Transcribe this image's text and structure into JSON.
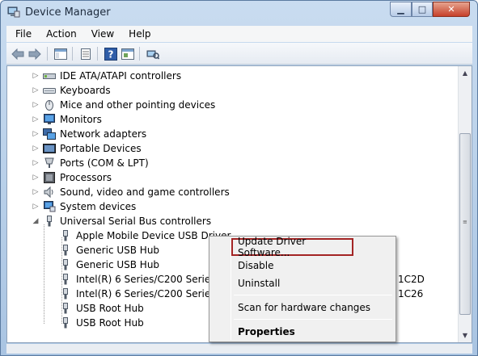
{
  "window": {
    "title": "Device Manager",
    "minimize_glyph": "▁",
    "maximize_glyph": "□",
    "close_glyph": "✕"
  },
  "menu": [
    "File",
    "Action",
    "View",
    "Help"
  ],
  "toolbar": {
    "buttons": [
      "back-icon",
      "forward-icon",
      "show-hide-tree-icon",
      "properties-icon",
      "help-icon",
      "update-driver-icon",
      "scan-hardware-icon"
    ]
  },
  "tree": {
    "categories": [
      {
        "label": "IDE ATA/ATAPI controllers",
        "icon": "ide-controller-icon"
      },
      {
        "label": "Keyboards",
        "icon": "keyboard-icon"
      },
      {
        "label": "Mice and other pointing devices",
        "icon": "mouse-icon"
      },
      {
        "label": "Monitors",
        "icon": "monitor-icon"
      },
      {
        "label": "Network adapters",
        "icon": "network-adapter-icon"
      },
      {
        "label": "Portable Devices",
        "icon": "portable-device-icon"
      },
      {
        "label": "Ports (COM & LPT)",
        "icon": "port-icon"
      },
      {
        "label": "Processors",
        "icon": "processor-icon"
      },
      {
        "label": "Sound, video and game controllers",
        "icon": "sound-icon"
      },
      {
        "label": "System devices",
        "icon": "system-device-icon"
      },
      {
        "label": "Universal Serial Bus controllers",
        "icon": "usb-icon"
      }
    ],
    "usb_children": [
      {
        "label": "Apple Mobile Device USB Driver",
        "suffix": ""
      },
      {
        "label": "Generic USB Hub",
        "suffix": ""
      },
      {
        "label": "Generic USB Hub",
        "suffix": ""
      },
      {
        "label": "Intel(R) 6 Series/C200 Series Chip",
        "suffix": "1C2D"
      },
      {
        "label": "Intel(R) 6 Series/C200 Series Chip",
        "suffix": "1C26"
      },
      {
        "label": "USB Root Hub",
        "suffix": ""
      },
      {
        "label": "USB Root Hub",
        "suffix": ""
      }
    ]
  },
  "context_menu": {
    "update": "Update Driver Software...",
    "disable": "Disable",
    "uninstall": "Uninstall",
    "scan": "Scan for hardware changes",
    "properties": "Properties"
  },
  "colors": {
    "highlight_border": "#a32424",
    "title_bar": "#c9dcf0"
  }
}
